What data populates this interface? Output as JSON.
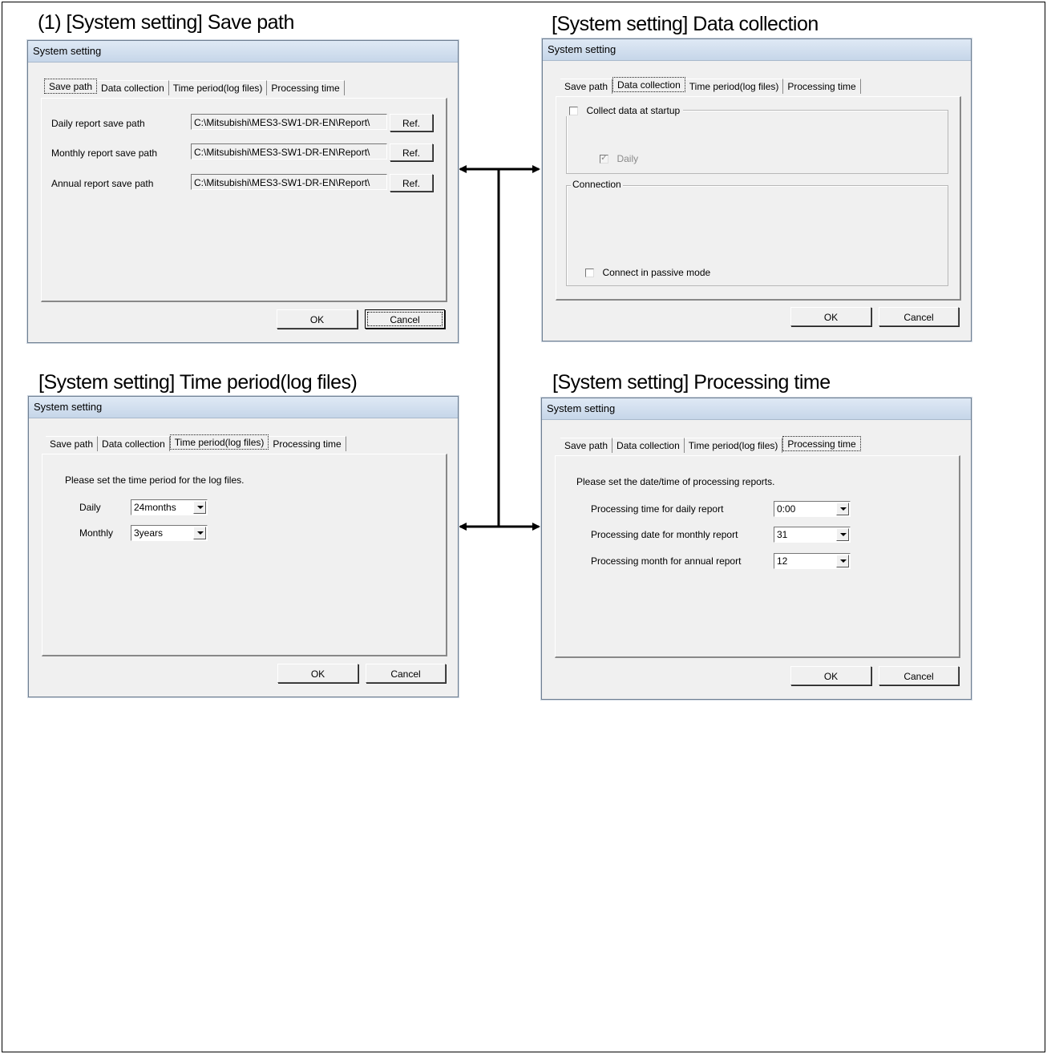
{
  "sections": {
    "save_path_title": "(1)  [System setting] Save path",
    "data_collection_title": "[System setting] Data collection",
    "time_period_title": "[System setting] Time period(log files)",
    "processing_time_title": "[System setting] Processing time"
  },
  "dialog": {
    "title": "System setting",
    "tabs": [
      "Save path",
      "Data collection",
      "Time period(log files)",
      "Processing time"
    ],
    "ok_label": "OK",
    "cancel_label": "Cancel"
  },
  "save_path": {
    "rows": [
      {
        "label": "Daily report save path",
        "value": "C:\\Mitsubishi\\MES3-SW1-DR-EN\\Report\\",
        "button": "Ref."
      },
      {
        "label": "Monthly report save path",
        "value": "C:\\Mitsubishi\\MES3-SW1-DR-EN\\Report\\",
        "button": "Ref."
      },
      {
        "label": "Annual report save path",
        "value": "C:\\Mitsubishi\\MES3-SW1-DR-EN\\Report\\",
        "button": "Ref."
      }
    ]
  },
  "data_collection": {
    "collect_at_startup_label": "Collect data at startup",
    "collect_at_startup_checked": false,
    "daily_label": "Daily",
    "daily_checked": true,
    "connection_group_label": "Connection",
    "passive_mode_label": "Connect in passive mode",
    "passive_mode_checked": false
  },
  "time_period": {
    "instruction": "Please set the time period for the log files.",
    "daily_label": "Daily",
    "daily_value": "24months",
    "monthly_label": "Monthly",
    "monthly_value": "3years"
  },
  "processing_time": {
    "instruction": "Please set the date/time of processing reports.",
    "rows": [
      {
        "label": "Processing time for daily report",
        "value": "0:00"
      },
      {
        "label": "Processing date for monthly report",
        "value": "31"
      },
      {
        "label": "Processing month for annual report",
        "value": "12"
      }
    ]
  },
  "colors": {
    "dialog_bg": "#f0f0f0",
    "titlebar": "#c6d6e9",
    "dialog_border": "#6f7f92"
  }
}
